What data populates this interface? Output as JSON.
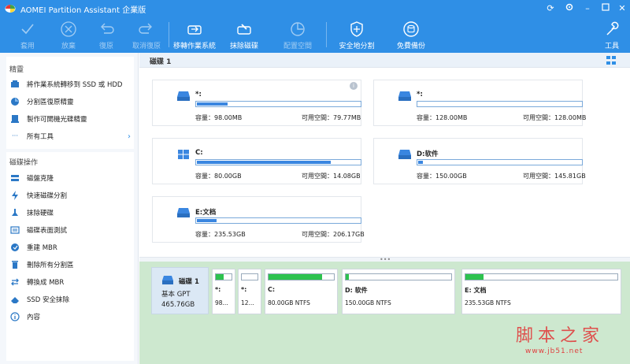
{
  "app": {
    "title": "AOMEI Partition Assistant 企業版"
  },
  "toolbar": {
    "apply": "套用",
    "discard": "放棄",
    "undo": "復原",
    "redo": "取消復原",
    "migrate_os": "移轉作業系統",
    "wipe_disk": "抹除磁碟",
    "allocate_space": "配置空間",
    "secure_partition": "安全地分割",
    "free_backup": "免費備份",
    "tools": "工具"
  },
  "sidebar": {
    "wizards_title": "精靈",
    "wizards": [
      {
        "label": "將作業系統轉移到 SSD 或 HDD",
        "icon": "migrate-icon"
      },
      {
        "label": "分割區復原精靈",
        "icon": "partition-recovery-icon"
      },
      {
        "label": "製作可開機光碟精靈",
        "icon": "bootable-media-icon"
      },
      {
        "label": "所有工具",
        "icon": "more-icon"
      }
    ],
    "disk_ops_title": "磁碟操作",
    "disk_ops": [
      {
        "label": "磁盤克隆",
        "icon": "clone-icon"
      },
      {
        "label": "快速磁碟分割",
        "icon": "quick-partition-icon"
      },
      {
        "label": "抹除硬碟",
        "icon": "wipe-icon"
      },
      {
        "label": "磁碟表面測試",
        "icon": "surface-test-icon"
      },
      {
        "label": "重建 MBR",
        "icon": "rebuild-mbr-icon"
      },
      {
        "label": "刪除所有分割區",
        "icon": "delete-icon"
      },
      {
        "label": "轉換成 MBR",
        "icon": "convert-icon"
      },
      {
        "label": "SSD 安全抹除",
        "icon": "ssd-erase-icon"
      },
      {
        "label": "內容",
        "icon": "info-icon"
      }
    ]
  },
  "disk_header": {
    "label": "磁碟 1"
  },
  "partitions": [
    {
      "name": "*:",
      "capacity": "容量：98.00MB",
      "free": "可用空間：79.77MB",
      "used_fraction": 0.19,
      "icon": "drive-icon"
    },
    {
      "name": "*:",
      "capacity": "容量：128.00MB",
      "free": "可用空間：128.00MB",
      "used_fraction": 0.0,
      "icon": "drive-icon"
    },
    {
      "name": "C:",
      "capacity": "容量：80.00GB",
      "free": "可用空間：14.08GB",
      "used_fraction": 0.82,
      "icon": "windows-icon"
    },
    {
      "name": "D:软件",
      "capacity": "容量：150.00GB",
      "free": "可用空間：145.81GB",
      "used_fraction": 0.03,
      "icon": "drive-icon"
    },
    {
      "name": "E:文档",
      "capacity": "容量：235.53GB",
      "free": "可用空間：206.17GB",
      "used_fraction": 0.12,
      "icon": "drive-icon"
    }
  ],
  "diskmap": {
    "disk_name": "磁碟 1",
    "disk_type": "基本 GPT",
    "disk_size": "465.76GB",
    "parts": [
      {
        "name": "*:",
        "info": "98...",
        "used_fraction": 0.5
      },
      {
        "name": "*:",
        "info": "12...",
        "used_fraction": 0.0
      },
      {
        "name": "C:",
        "info": "80.00GB NTFS",
        "used_fraction": 0.82
      },
      {
        "name": "D: 软件",
        "info": "150.00GB NTFS",
        "used_fraction": 0.03
      },
      {
        "name": "E: 文档",
        "info": "235.53GB NTFS",
        "used_fraction": 0.12
      }
    ]
  },
  "watermark": {
    "text": "脚本之家",
    "url": "www.jb51.net"
  },
  "colors": {
    "toolbar_bg": "#2f8fe6",
    "bar_fill": "#3a86e0",
    "map_fill": "#2dc24e",
    "map_bg": "#cde8cf"
  }
}
